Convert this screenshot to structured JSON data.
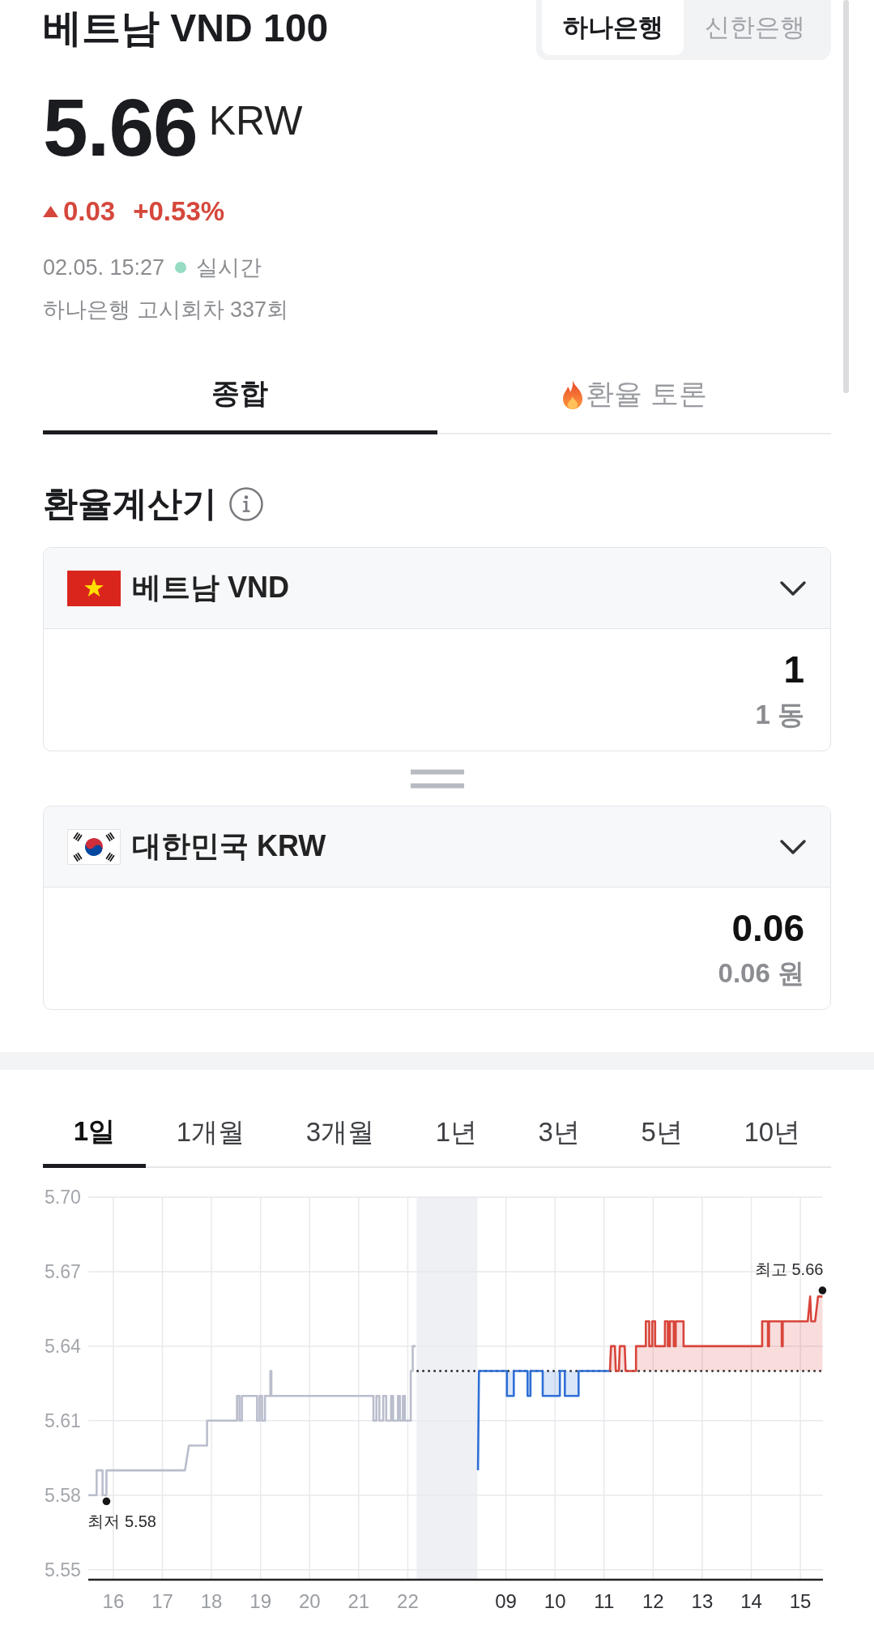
{
  "header": {
    "title": "베트남 VND 100",
    "banks": [
      {
        "label": "하나은행",
        "selected": true
      },
      {
        "label": "신한은행",
        "selected": false
      }
    ]
  },
  "quote": {
    "price": "5.66",
    "unit": "KRW",
    "rising": true,
    "change": "0.03",
    "change_percent": "+0.53%",
    "timestamp": "02.05. 15:27",
    "live": true,
    "live_label": "실시간",
    "notice": "하나은행 고시회차 337회"
  },
  "tabs": [
    {
      "label": "종합",
      "selected": true,
      "kind": "plain"
    },
    {
      "label": "환율 토론",
      "selected": false,
      "kind": "trending"
    }
  ],
  "calculator": {
    "title": "환율계산기",
    "currencies": [
      {
        "kind": "vnd",
        "name": "베트남 VND",
        "amount": "1",
        "amount_text": "1 동"
      },
      {
        "kind": "krw",
        "name": "대한민국 KRW",
        "amount": "0.06",
        "amount_text": "0.06 원"
      }
    ]
  },
  "chart": {
    "periods": [
      {
        "label": "1일",
        "selected": true
      },
      {
        "label": "1개월",
        "selected": false
      },
      {
        "label": "3개월",
        "selected": false
      },
      {
        "label": "1년",
        "selected": false
      },
      {
        "label": "3년",
        "selected": false
      },
      {
        "label": "5년",
        "selected": false
      },
      {
        "label": "10년",
        "selected": false
      }
    ],
    "sessions": [
      {
        "current": false,
        "chart_data": {
          "type": "line",
          "grid": true,
          "xlim": [
            15.49,
            22.18
          ],
          "ylim": [
            5.546,
            5.7
          ],
          "xticks": [
            16,
            17,
            18,
            19,
            20,
            21,
            22
          ],
          "yticks": [
            5.55,
            5.58,
            5.61,
            5.64,
            5.67,
            {
              "value": 5.7,
              "label": "5.70"
            }
          ],
          "series": [
            {
              "color": "#b9bdcc",
              "x": [
                15.49,
                15.66,
                15.66,
                15.78,
                15.78,
                15.86,
                15.86,
                17.46,
                17.54,
                17.91,
                17.91,
                18.52,
                18.52,
                18.57,
                18.57,
                18.62,
                18.62,
                18.93,
                18.93,
                18.98,
                18.98,
                19.03,
                19.03,
                19.09,
                19.09,
                19.2,
                19.2,
                19.22,
                19.22,
                21.3,
                21.3,
                21.36,
                21.36,
                21.42,
                21.42,
                21.5,
                21.5,
                21.56,
                21.56,
                21.66,
                21.66,
                21.7,
                21.7,
                21.8,
                21.8,
                21.84,
                21.84,
                21.9,
                21.9,
                21.94,
                21.94,
                22.06,
                22.06,
                22.1,
                22.1,
                22.16
              ],
              "values": [
                5.58,
                5.58,
                5.59,
                5.59,
                5.58,
                5.58,
                5.59,
                5.59,
                5.6,
                5.6,
                5.61,
                5.61,
                5.62,
                5.62,
                5.61,
                5.61,
                5.62,
                5.62,
                5.61,
                5.61,
                5.62,
                5.62,
                5.61,
                5.61,
                5.62,
                5.62,
                5.63,
                5.63,
                5.62,
                5.62,
                5.61,
                5.61,
                5.62,
                5.62,
                5.61,
                5.61,
                5.62,
                5.62,
                5.61,
                5.61,
                5.62,
                5.62,
                5.61,
                5.61,
                5.62,
                5.62,
                5.61,
                5.61,
                5.62,
                5.62,
                5.61,
                5.61,
                5.63,
                5.63,
                5.64,
                5.64
              ]
            }
          ],
          "annotations": [
            {
              "text": "최저 5.58"
            }
          ]
        }
      },
      {
        "current": true,
        "chart_data": {
          "type": "line",
          "grid": true,
          "xlim": [
            7.18,
            15.46
          ],
          "ylim": [
            5.546,
            5.7
          ],
          "xticks": [
            {
              "value": 9,
              "label": "09"
            },
            10,
            11,
            12,
            13,
            14,
            15
          ],
          "series": [
            {
              "color": "#2f6fd6",
              "x": [
                8.43,
                8.45,
                9.02,
                9.02,
                9.16,
                9.16,
                9.44,
                9.44,
                9.5,
                9.5,
                9.75,
                9.75,
                10.1,
                10.1,
                10.2,
                10.2,
                10.48,
                10.48,
                11.12
              ],
              "values": [
                5.59,
                5.63,
                5.63,
                5.62,
                5.62,
                5.63,
                5.63,
                5.62,
                5.62,
                5.63,
                5.63,
                5.62,
                5.62,
                5.63,
                5.63,
                5.62,
                5.62,
                5.63,
                5.63
              ]
            },
            {
              "color": "#d8453b",
              "x": [
                11.12,
                11.14,
                11.22,
                11.24,
                11.3,
                11.32,
                11.42,
                11.44,
                11.65,
                11.65,
                11.85,
                11.85,
                11.92,
                11.92,
                11.98,
                11.98,
                12.04,
                12.04,
                12.24,
                12.24,
                12.3,
                12.3,
                12.34,
                12.34,
                12.42,
                12.42,
                12.46,
                12.46,
                12.62,
                12.62,
                14.22,
                14.22,
                14.34,
                14.34,
                14.36,
                14.36,
                14.62,
                14.62,
                14.64,
                14.64,
                15.15,
                15.2,
                15.22,
                15.3,
                15.36,
                15.45
              ],
              "values": [
                5.63,
                5.64,
                5.64,
                5.63,
                5.63,
                5.64,
                5.64,
                5.63,
                5.63,
                5.64,
                5.64,
                5.65,
                5.65,
                5.64,
                5.64,
                5.65,
                5.65,
                5.64,
                5.64,
                5.65,
                5.65,
                5.64,
                5.64,
                5.65,
                5.65,
                5.64,
                5.64,
                5.65,
                5.65,
                5.64,
                5.64,
                5.65,
                5.65,
                5.64,
                5.64,
                5.65,
                5.65,
                5.64,
                5.64,
                5.65,
                5.65,
                5.66,
                5.65,
                5.65,
                5.66,
                5.66
              ]
            }
          ],
          "bands": [
            {
              "axis": "x",
              "from": 7.18,
              "to": 8.42
            }
          ],
          "ref_lines": [
            {
              "axis": "y",
              "value": 5.63
            }
          ],
          "annotations": [
            {
              "text": "최고 5.66"
            }
          ]
        }
      }
    ]
  }
}
